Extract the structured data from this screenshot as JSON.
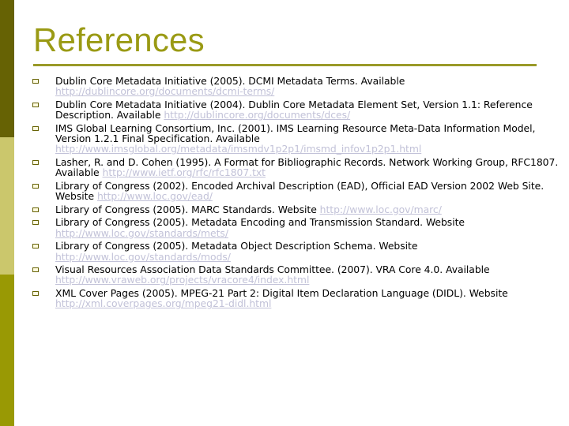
{
  "colors": {
    "sidebar_top": "#666204",
    "sidebar_mid": "#cbc76c",
    "sidebar_bottom": "#999904",
    "title": "#9a9a14",
    "rule": "#9a9a28",
    "bullet": "#666204",
    "link": "#c2c2d8"
  },
  "slide": {
    "title": "References",
    "bullet_icon": "hollow-square-icon",
    "references": [
      {
        "text": "Dublin Core Metadata Initiative (2005). DCMI Metadata Terms. Available ",
        "link": "http://dublincore.org/documents/dcmi-terms/"
      },
      {
        "text": "Dublin Core Metadata Initiative (2004). Dublin Core Metadata Element Set, Version 1.1: Reference Description. Available ",
        "link": "http://dublincore.org/documents/dces/"
      },
      {
        "text": "IMS Global Learning Consortium, Inc. (2001). IMS Learning Resource Meta-Data Information Model, Version 1.2.1 Final Specification. Available ",
        "link": "http://www.imsglobal.org/metadata/imsmdv1p2p1/imsmd_infov1p2p1.html"
      },
      {
        "text": "Lasher, R. and D. Cohen (1995). A Format for Bibliographic Records. Network Working Group, RFC1807. Available ",
        "link": "http://www.ietf.org/rfc/rfc1807.txt"
      },
      {
        "text": "Library of Congress (2002). Encoded Archival Description (EAD), Official EAD Version 2002 Web Site. Website ",
        "link": "http://www.loc.gov/ead/"
      },
      {
        "text": "Library of Congress (2005). MARC Standards. Website ",
        "link": "http://www.loc.gov/marc/"
      },
      {
        "text": "Library of Congress (2005). Metadata Encoding and Transmission Standard. Website ",
        "link": "http://www.loc.gov/standards/mets/"
      },
      {
        "text": "Library of Congress (2005). Metadata Object Description Schema. Website ",
        "link": "http://www.loc.gov/standards/mods/"
      },
      {
        "text": "Visual Resources Association Data Standards Committee. (2007). VRA Core 4.0. Available ",
        "link": "http://www.vraweb.org/projects/vracore4/index.html"
      },
      {
        "text": "XML Cover Pages (2005). MPEG-21 Part 2: Digital Item Declaration Language (DIDL). Website ",
        "link": "http://xml.coverpages.org/mpeg21-didl.html"
      }
    ]
  }
}
